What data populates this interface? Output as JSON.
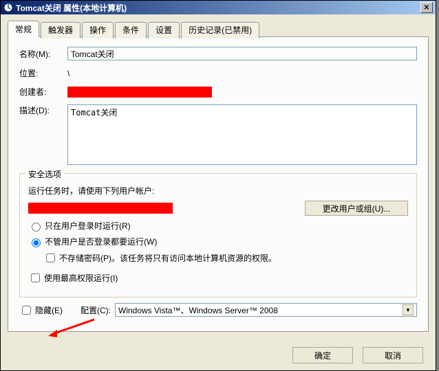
{
  "titlebar": {
    "text": "Tomcat关闭 属性(本地计算机)"
  },
  "tabs": {
    "general": "常规",
    "triggers": "触发器",
    "actions": "操作",
    "conditions": "条件",
    "settings": "设置",
    "history": "历史记录(已禁用)"
  },
  "labels": {
    "name": "名称(M):",
    "location": "位置:",
    "author": "创建者:",
    "description": "描述(D):",
    "security_legend": "安全选项",
    "run_as_prompt": "运行任务时，请使用下列用户帐户:",
    "change_user_btn": "更改用户或组(U)...",
    "only_logged": "只在用户登录时运行(R)",
    "run_whether": "不管用户是否登录都要运行(W)",
    "no_store_pwd": "不存储密码(P)。该任务将只有访问本地计算机资源的权限。",
    "highest_priv": "使用最高权限运行(I)",
    "hidden": "隐藏(E)",
    "configure_for": "配置(C):",
    "ok": "确定",
    "cancel": "取消"
  },
  "values": {
    "name": "Tomcat关闭",
    "location": "\\",
    "description": "Tomcat关闭",
    "configure_for": "Windows Vista™、Windows Server™ 2008"
  },
  "state": {
    "run_mode": "whether",
    "no_store_pwd": false,
    "highest_priv": false,
    "hidden": false
  }
}
